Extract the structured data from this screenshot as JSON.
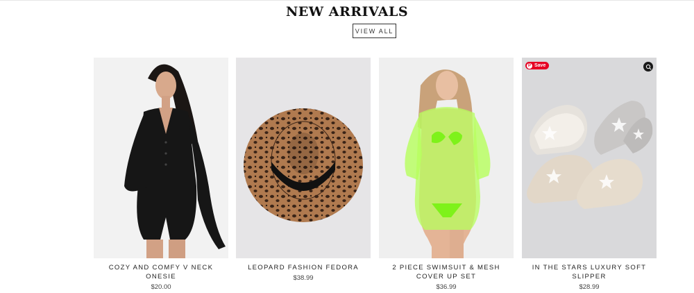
{
  "section": {
    "title": "NEW ARRIVALS",
    "view_all_label": "VIEW ALL"
  },
  "products": [
    {
      "name": "COZY AND COMFY V NECK ONESIE",
      "price": "$20.00",
      "image": "black-romper-model"
    },
    {
      "name": "LEOPARD FASHION FEDORA",
      "price": "$38.99",
      "image": "leopard-fedora-hat"
    },
    {
      "name": "2 PIECE SWIMSUIT & MESH COVER UP SET",
      "price": "$36.99",
      "image": "neon-mesh-swimsuit-model"
    },
    {
      "name": "IN THE STARS LUXURY SOFT SLIPPER",
      "price": "$28.99",
      "image": "star-slippers"
    }
  ],
  "overlay": {
    "save_label": "Save",
    "save_color": "#e60023",
    "zoom_icon": "zoom-lens-icon"
  }
}
